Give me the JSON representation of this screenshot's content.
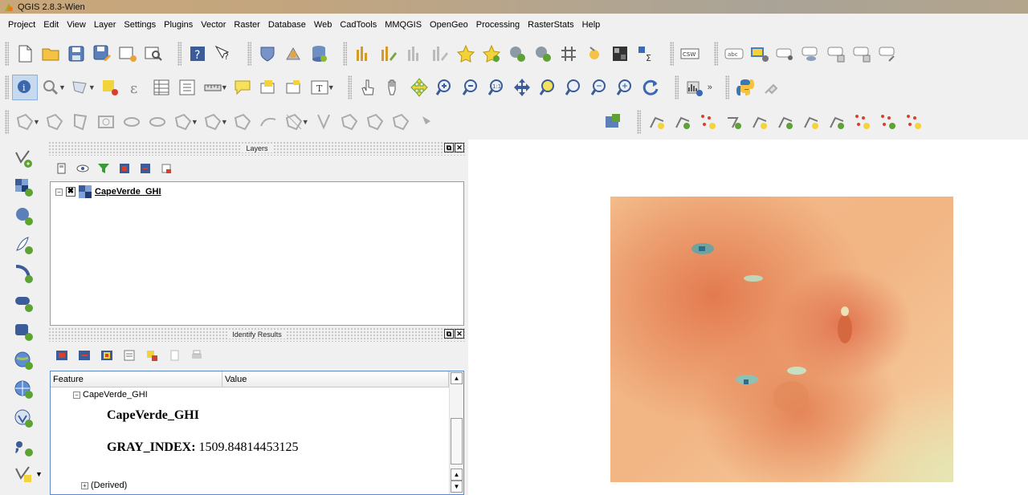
{
  "window": {
    "title": "QGIS 2.8.3-Wien"
  },
  "menu": [
    "Project",
    "Edit",
    "View",
    "Layer",
    "Settings",
    "Plugins",
    "Vector",
    "Raster",
    "Database",
    "Web",
    "CadTools",
    "MMQGIS",
    "OpenGeo",
    "Processing",
    "RasterStats",
    "Help"
  ],
  "toolbar1": {
    "csw_label": "CSW"
  },
  "layers_panel": {
    "title": "Layers",
    "layer": {
      "name": "CapeVerde_GHI",
      "checked": "✖"
    }
  },
  "identify_panel": {
    "title": "Identify Results",
    "columns": {
      "feature": "Feature",
      "value": "Value"
    },
    "tree_layer": "CapeVerde_GHI",
    "attr_layer_name": "CapeVerde_GHI",
    "attr_key": "GRAY_INDEX:",
    "attr_value": "1509.84814453125",
    "derived": "(Derived)"
  },
  "colors": {
    "accent_blue": "#1a4f9c",
    "raster_orange": "#e88a5a",
    "raster_light": "#f6c893"
  }
}
